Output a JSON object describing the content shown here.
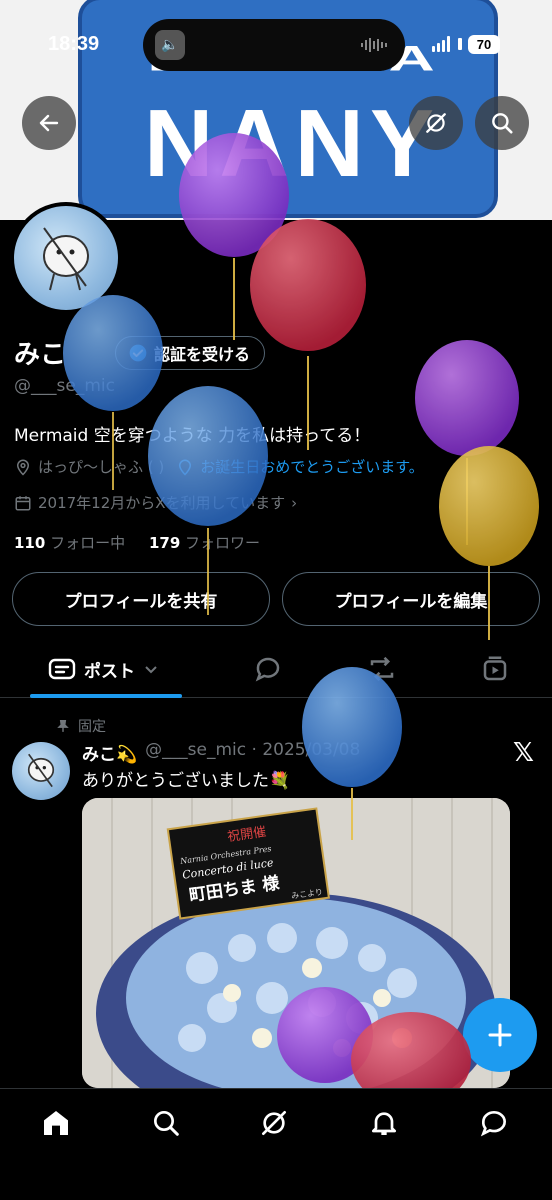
{
  "status_bar": {
    "time": "18:39",
    "battery": "70"
  },
  "banner": {
    "line1": "DAKARA",
    "line2": "NANY"
  },
  "profile": {
    "name": "みこ",
    "verify_label": "認証を受ける",
    "handle": "@___se_mic",
    "bio": "Mermaid 空を穿つような 力を私は持ってる！",
    "location": "はっぴ〜しゃふ (  )",
    "birthday_link": "お誕生日おめでとうございます。",
    "joined": "2017年12月からXを利用しています",
    "following_count": "110",
    "following_label": "フォロー中",
    "followers_count": "179",
    "followers_label": "フォロワー",
    "share_label": "プロフィールを共有",
    "edit_label": "プロフィールを編集"
  },
  "tabs": {
    "posts_label": "ポスト"
  },
  "post": {
    "pinned_label": "固定",
    "author": "みこ💫",
    "handle_date": "@___se_mic · 2025/03/08",
    "text": "ありがとうございました💐",
    "sign_top": "祝開催",
    "sign_sub1": "Narnia Orchestra Pres",
    "sign_sub2": "Concerto di luce",
    "sign_name": "町田ちま 様",
    "sign_from": "みこより"
  },
  "colors": {
    "accent": "#1d9bf0",
    "background": "#000000",
    "muted": "#71767b"
  },
  "icons": [
    "back-arrow-icon",
    "grok-icon",
    "search-icon",
    "calendar-icon",
    "location-icon",
    "balloon-icon",
    "reply-icon",
    "repost-icon",
    "media-icon",
    "pin-icon",
    "home-icon",
    "notifications-icon",
    "messages-icon"
  ]
}
